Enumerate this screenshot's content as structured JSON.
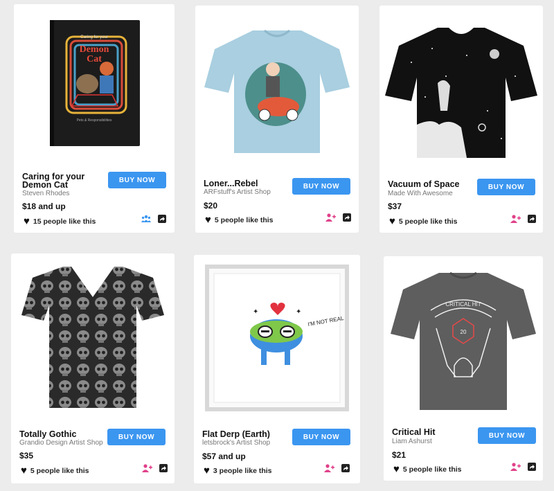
{
  "products": [
    {
      "title": "Caring for your Demon Cat",
      "artist": "Steven Rhodes",
      "price": "$18 and up",
      "buy_label": "BUY NOW",
      "likes": "15 people like this",
      "action_icon": "people-group-icon",
      "action_color": "#3b96f0",
      "art": {
        "type": "notebook",
        "cover_lines": [
          "Caring for your",
          "Demon",
          "Cat",
          "Pets & Responsibilities"
        ]
      }
    },
    {
      "title": "Loner...Rebel",
      "artist": "ARFstuff's Artist Shop",
      "price": "$20",
      "buy_label": "BUY NOW",
      "likes": "5 people like this",
      "action_icon": "add-person-icon",
      "action_color": "#e0408a",
      "art": {
        "type": "tshirt",
        "shirt_color": "#a9cfe0"
      }
    },
    {
      "title": "Vacuum of Space",
      "artist": "Made With Awesome",
      "price": "$37",
      "buy_label": "BUY NOW",
      "likes": "5 people like this",
      "action_icon": "add-person-icon",
      "action_color": "#e0408a",
      "art": {
        "type": "tshirt",
        "shirt_color": "#111111"
      }
    },
    {
      "title": "Totally Gothic",
      "artist": "Grandio Design Artist Shop",
      "price": "$35",
      "buy_label": "BUY NOW",
      "likes": "5 people like this",
      "action_icon": "add-person-icon",
      "action_color": "#e0408a",
      "art": {
        "type": "vneck",
        "shirt_color": "#2a2a2a"
      }
    },
    {
      "title": "Flat Derp (Earth)",
      "artist": "letsbrock's Artist Shop",
      "price": "$57 and up",
      "buy_label": "BUY NOW",
      "likes": "3 people like this",
      "action_icon": "add-person-icon",
      "action_color": "#e0408a",
      "art": {
        "type": "frame",
        "caption": "I'M NOT REAL"
      }
    },
    {
      "title": "Critical Hit",
      "artist": "Liam Ashurst",
      "price": "$21",
      "buy_label": "BUY NOW",
      "likes": "5 people like this",
      "action_icon": "add-person-icon",
      "action_color": "#e0408a",
      "art": {
        "type": "tshirt",
        "shirt_color": "#5e5e5e",
        "print_text": "CRITICAL HIT",
        "die_number": "20"
      }
    }
  ]
}
